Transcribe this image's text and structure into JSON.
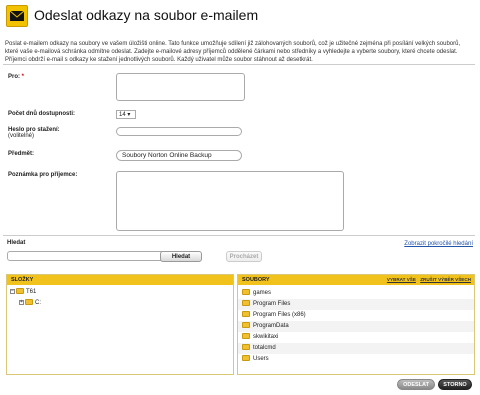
{
  "header": {
    "title": "Odeslat odkazy na soubor e-mailem",
    "icon": "envelope-icon"
  },
  "intro": "Poslat e-mailem odkazy na soubory ve vašem úložišti online. Tato funkce umožňuje sdílení již zálohovaných souborů, což je užitečné zejména při posílání velkých souborů, které vaše e-mailová schránka odmítne odeslat. Zadejte e-mailové adresy příjemců oddělené čárkami nebo středníky a vyhledejte a vyberte soubory, které chcete odeslat. Příjemci obdrží e-mail s odkazy ke stažení jednotlivých souborů. Každý uživatel může soubor stáhnout až desetkrát.",
  "form": {
    "to_label": "Pro:",
    "to_required": "*",
    "days_label": "Počet dnů dostupnosti:",
    "days_value": "14 ▾",
    "password_label": "Heslo pro stažení:",
    "password_sub": "(volitelné)",
    "subject_label": "Předmět:",
    "subject_value": "Soubory Norton Online Backup",
    "note_label": "Poznámka pro příjemce:"
  },
  "search": {
    "label": "Hledat",
    "advanced_link": "Zobrazit pokročilé hledání",
    "search_button": "Hledat",
    "browse_button": "Procházet"
  },
  "tree": {
    "header": "SLOŽKY",
    "items": [
      {
        "expander": "⊟",
        "label": "T61"
      },
      {
        "expander": "⊞",
        "label": "C:"
      }
    ]
  },
  "files": {
    "header": "SOUBORY",
    "select_all": "VYBRAT VŠE",
    "clear_selection": "ZRUŠIT VÝBĚR VŠECH",
    "items": [
      "games",
      "Program Files",
      "Program Files (x86)",
      "ProgramData",
      "skwikitaxi",
      "totalcmd",
      "Users"
    ]
  },
  "footer": {
    "send": "ODESLAT",
    "cancel": "STORNO"
  },
  "colors": {
    "accent": "#f1c21b",
    "link": "#2255aa",
    "required": "#dd0000"
  }
}
